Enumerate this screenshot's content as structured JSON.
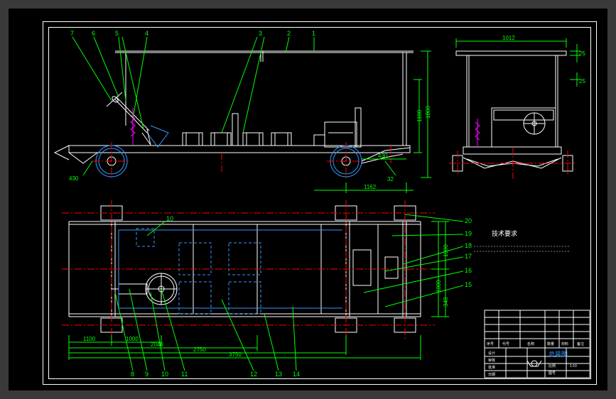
{
  "drawing": {
    "type": "engineering_drawing",
    "description": "Vehicle chassis / cart assembly drawing with side elevation, top plan view, and front view",
    "views": [
      "side_elevation",
      "top_plan",
      "front_view"
    ],
    "callouts_top": [
      "1",
      "2",
      "3",
      "4",
      "5",
      "6",
      "7"
    ],
    "callouts_bottom": [
      "8",
      "9",
      "10",
      "11",
      "12",
      "13",
      "14"
    ],
    "callouts_right": [
      "15",
      "16",
      "17",
      "18",
      "19",
      "20"
    ],
    "callout_between": "10",
    "dimensions": {
      "front_width": "1012",
      "front_height_upper": "25",
      "front_height_top": "25",
      "side_height_total": "1800",
      "side_height_body": "1100",
      "side_wheelbase": "1162",
      "side_front_offset": "430",
      "side_tire_small": "32",
      "side_front_tire": "430",
      "plan_width_1": "1100",
      "plan_width_2": "1000",
      "plan_length_1": "2040",
      "plan_length_2": "2750",
      "plan_length_3": "3750",
      "plan_right_1": "1000",
      "plan_right_2": "348",
      "plan_right_3": "1000"
    },
    "title_block": {
      "dwg_name": "总装图",
      "scale": "1:10",
      "material": "",
      "sheet": "",
      "design_label": "设计",
      "check_label": "审核",
      "approve_label": "批准",
      "date_label": "日期",
      "scale_label": "比例",
      "weight_label": "重量",
      "part_no_label": "图号",
      "col_headers": [
        "序号",
        "代号",
        "名称",
        "数量",
        "材料",
        "备注"
      ]
    },
    "annotation_text": "技术要求"
  }
}
